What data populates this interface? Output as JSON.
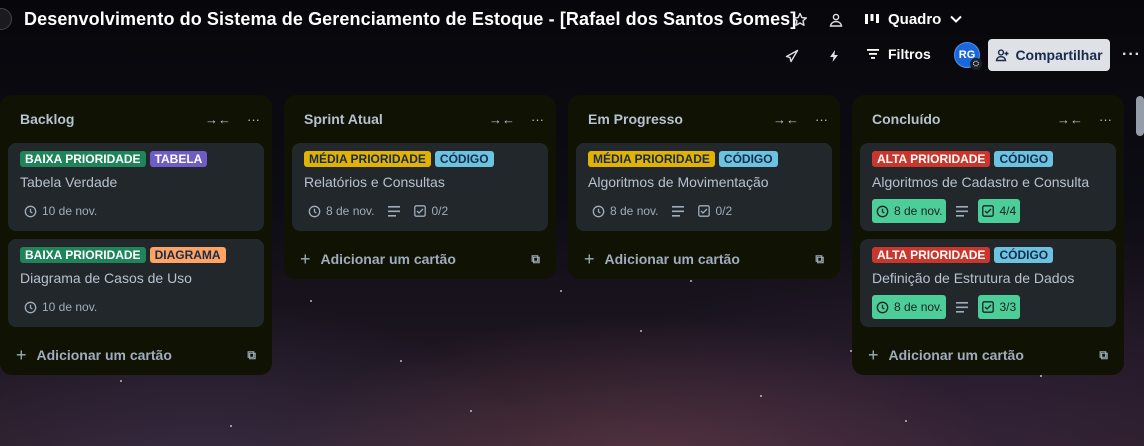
{
  "board": {
    "title": "Desenvolvimento do Sistema de Gerenciamento de Estoque - [Rafael dos Santos Gomes]",
    "view": "Quadro",
    "filters_label": "Filtros",
    "share_label": "Compartilhar",
    "avatar_initials": "RG"
  },
  "icons": {
    "star": "star-icon",
    "visibility": "team-visibility-icon",
    "board": "board-view-icon",
    "chevron": "chevron-down-icon",
    "power_ups": "rocket-icon",
    "automation": "lightning-icon",
    "filter": "filter-lines-icon",
    "share": "add-person-icon",
    "more": "ellipsis-icon"
  },
  "colors": {
    "green_label": "#1f845a",
    "purple_label": "#6e5dc6",
    "orange_label": "#fea362",
    "yellow_label": "#e2b203",
    "blue_label": "#6cc3e0",
    "red_label": "#c9372c",
    "done_badge": "#4bce97"
  },
  "add_card_label": "Adicionar um cartão",
  "lists": [
    {
      "title": "Backlog",
      "cards": [
        {
          "labels": [
            "BAIXA PRIORIDADE",
            "TABELA"
          ],
          "title": "Tabela Verdade",
          "date": "10 de nov."
        },
        {
          "labels": [
            "BAIXA PRIORIDADE",
            "DIAGRAMA"
          ],
          "title": "Diagrama de Casos de Uso",
          "date": "10 de nov."
        }
      ]
    },
    {
      "title": "Sprint Atual",
      "cards": [
        {
          "labels": [
            "MÉDIA PRIORIDADE",
            "CÓDIGO"
          ],
          "title": "Relatórios e Consultas",
          "date": "8 de nov.",
          "checklist": "0/2"
        }
      ]
    },
    {
      "title": "Em Progresso",
      "cards": [
        {
          "labels": [
            "MÉDIA PRIORIDADE",
            "CÓDIGO"
          ],
          "title": "Algoritmos de Movimentação",
          "date": "8 de nov.",
          "checklist": "0/2"
        }
      ]
    },
    {
      "title": "Concluído",
      "cards": [
        {
          "labels": [
            "ALTA PRIORIDADE",
            "CÓDIGO"
          ],
          "title": "Algoritmos de Cadastro e Consulta",
          "date": "8 de nov.",
          "checklist": "4/4"
        },
        {
          "labels": [
            "ALTA PRIORIDADE",
            "CÓDIGO"
          ],
          "title": "Definição de Estrutura de Dados",
          "date": "8 de nov.",
          "checklist": "3/3"
        }
      ]
    }
  ]
}
